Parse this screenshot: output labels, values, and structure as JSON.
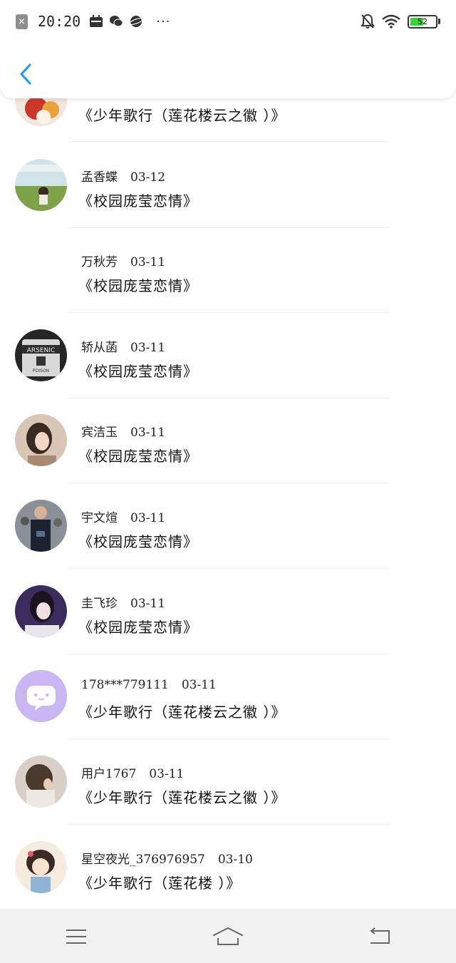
{
  "status_bar": {
    "time": "20:20",
    "battery_level": "52",
    "battery_fraction": 0.52,
    "notification_box": "×",
    "more_dots": "···",
    "icons": [
      "close-box-icon",
      "calendar-icon",
      "wechat-icon",
      "planet-icon",
      "bell-off-icon",
      "wifi-icon",
      "battery-icon"
    ]
  },
  "header": {
    "back_icon": "chevron-left-icon"
  },
  "comments": [
    {
      "name": "",
      "date": "",
      "work": "《少年歌行（莲花楼云之徽 ）》",
      "avatar": "food-photo"
    },
    {
      "name": "孟香蝶",
      "date": "03-12",
      "work": "《校园庞莹恋情》",
      "avatar": "field-photo"
    },
    {
      "name": "万秋芳",
      "date": "03-11",
      "work": "《校园庞莹恋情》",
      "avatar": "none"
    },
    {
      "name": "轿从菡",
      "date": "03-11",
      "work": "《校园庞莹恋情》",
      "avatar": "arsenic-poison-photo"
    },
    {
      "name": "宾洁玉",
      "date": "03-11",
      "work": "《校园庞莹恋情》",
      "avatar": "woman-portrait"
    },
    {
      "name": "宇文煊",
      "date": "03-11",
      "work": "《校园庞莹恋情》",
      "avatar": "man-street-photo"
    },
    {
      "name": "圭飞珍",
      "date": "03-11",
      "work": "《校园庞莹恋情》",
      "avatar": "woman-purple-portrait"
    },
    {
      "name": "178***779111",
      "date": "03-11",
      "work": "《少年歌行（莲花楼云之徽 ）》",
      "avatar": "chat-bubble-default"
    },
    {
      "name": "用户1767",
      "date": "03-11",
      "work": "《少年歌行（莲花楼云之徽 ）》",
      "avatar": "girl-back-photo"
    },
    {
      "name": "星空夜光_376976957",
      "date": "03-10",
      "work": "《少年歌行（莲花楼 ）》",
      "avatar": "anime-girl"
    }
  ],
  "nav": {
    "icons": [
      "menu-icon",
      "home-icon",
      "back-icon"
    ]
  },
  "colors": {
    "accent": "#2196f3",
    "battery": "#3dd13d",
    "avatar_default": "#c9b6f2"
  }
}
